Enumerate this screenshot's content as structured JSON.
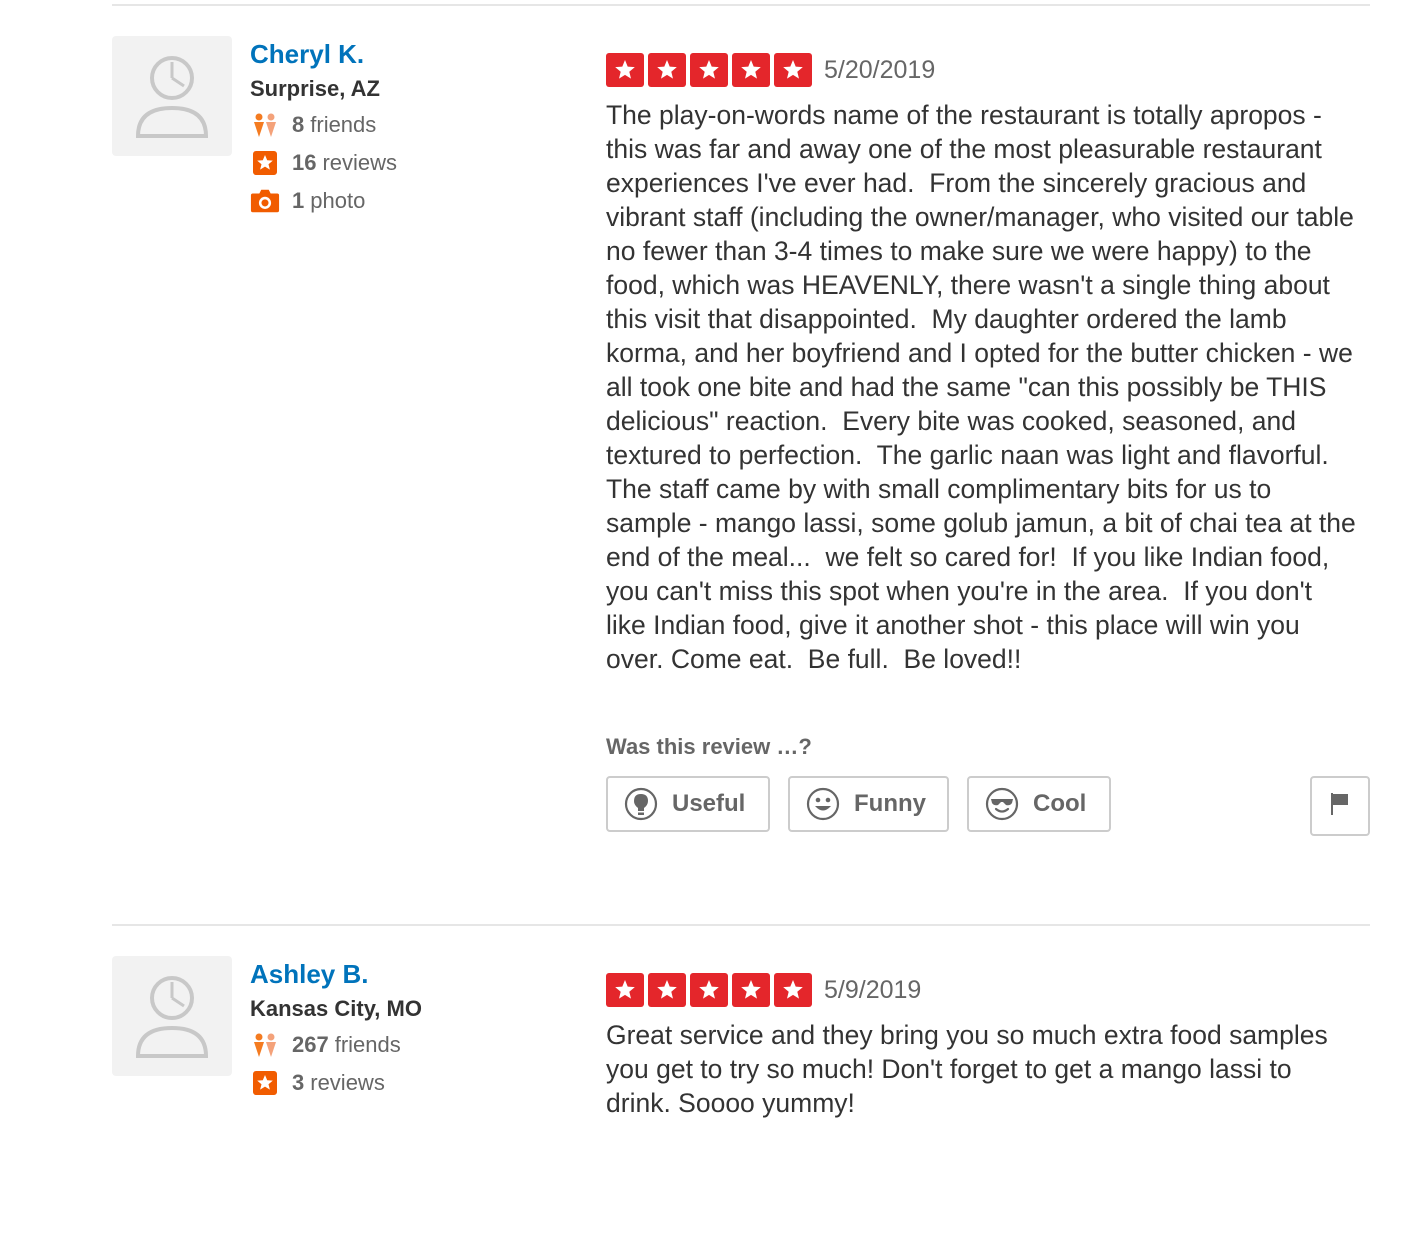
{
  "reviews": [
    {
      "user": {
        "name": "Cheryl K.",
        "location": "Surprise, AZ",
        "friends_count": "8",
        "friends_label": "friends",
        "reviews_count": "16",
        "reviews_label": "reviews",
        "photos_count": "1",
        "photos_label": "photo"
      },
      "rating": 5,
      "date": "5/20/2019",
      "text": "The play-on-words name of the restaurant is totally apropos - this was far and away one of the most pleasurable restaurant experiences I've ever had.  From the sincerely gracious and vibrant staff (including the owner/manager, who visited our table no fewer than 3-4 times to make sure we were happy) to the food, which was HEAVENLY, there wasn't a single thing about this visit that disappointed.  My daughter ordered the lamb korma, and her boyfriend and I opted for the butter chicken - we all took one bite and had the same \"can this possibly be THIS delicious\" reaction.  Every bite was cooked, seasoned, and textured to perfection.  The garlic naan was light and flavorful.  The staff came by with small complimentary bits for us to sample - mango lassi, some golub jamun, a bit of chai tea at the end of the meal...  we felt so cared for!  If you like Indian food, you can't miss this spot when you're in the area.  If you don't like Indian food, give it another shot - this place will win you over. Come eat.  Be full.  Be loved!!",
      "vote_prompt": "Was this review …?",
      "votes": {
        "useful": "Useful",
        "funny": "Funny",
        "cool": "Cool"
      }
    },
    {
      "user": {
        "name": "Ashley B.",
        "location": "Kansas City, MO",
        "friends_count": "267",
        "friends_label": "friends",
        "reviews_count": "3",
        "reviews_label": "reviews"
      },
      "rating": 5,
      "date": "5/9/2019",
      "text": "Great service and they bring you so much extra food samples you get to try so much! Don't forget to get a mango lassi to drink. Soooo yummy!"
    }
  ],
  "colors": {
    "link_blue": "#0073bb",
    "star_red": "#e4262b",
    "stat_orange": "#f15c00",
    "friends_orange": "#f47b20",
    "border_gray": "#cccccc"
  },
  "icons": {
    "avatar": "default-user-avatar-icon",
    "friends": "friends-icon",
    "reviews": "review-star-icon",
    "photo": "camera-icon",
    "useful": "lightbulb-icon",
    "funny": "smiley-icon",
    "cool": "sunglasses-icon",
    "flag": "flag-icon"
  }
}
